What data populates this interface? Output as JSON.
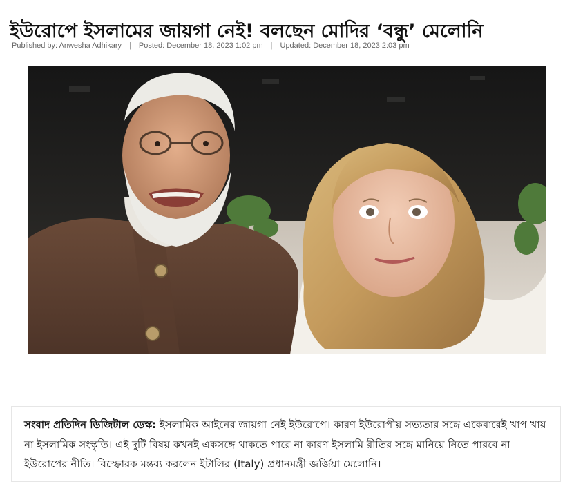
{
  "article": {
    "headline": "ইউরোপে ইসলামের জায়গা নেই! বলছেন মোদির ‘বন্ধু’ মেলোনি",
    "meta": {
      "published_by": "Published by: Anwesha Adhikary",
      "posted": "Posted: December 18, 2023 1:02 pm",
      "updated": "Updated: December 18, 2023 2:03 pm",
      "separator": "|"
    },
    "body": {
      "lead": "সংবাদ প্রতিদিন ডিজিটাল ডেস্ক:",
      "text": " ইসলামিক আইনের জায়গা নেই ইউরোপে। কারণ ইউরোপীয় সভ্যতার সঙ্গে একেবারেই খাপ খায় না ইসলামিক সংস্কৃতি। এই দুটি বিষয় কখনই একসঙ্গে থাকতে পারে না কারণ ইসলামি রীতির সঙ্গে মানিয়ে নিতে পারবে না ইউরোপের নীতি। বিস্ফোরক মন্তব্য করলেন ইটালির (Italy) প্রধানমন্ত্রী জর্জিয়া মেলোনি।"
    }
  }
}
